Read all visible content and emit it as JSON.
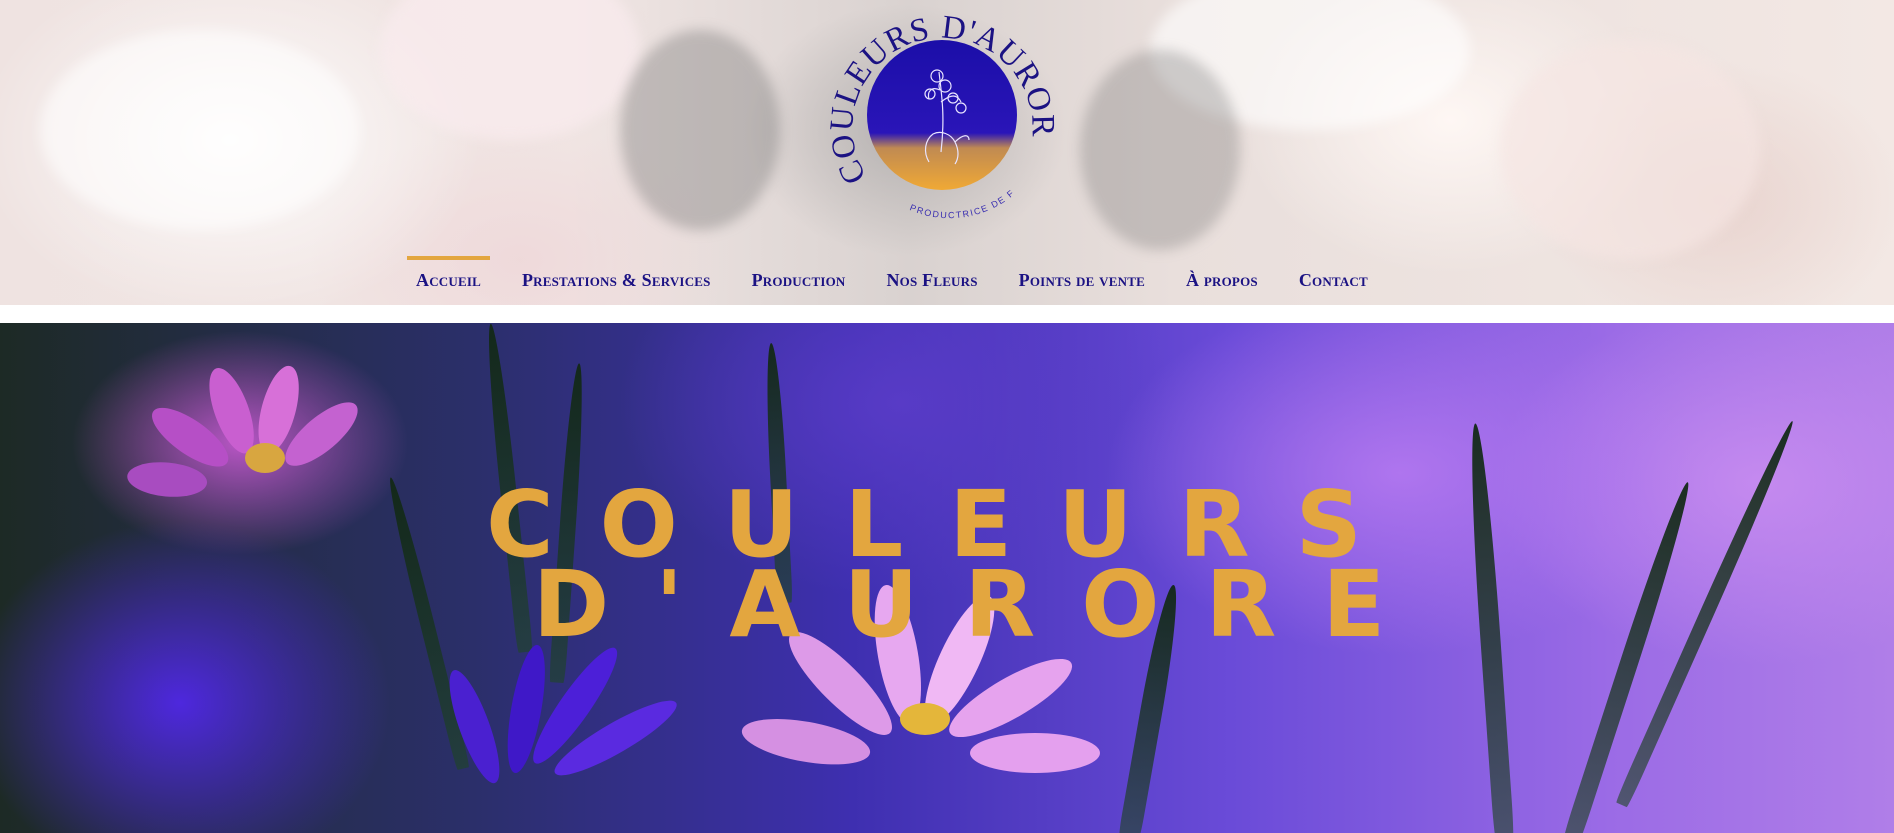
{
  "header": {
    "logo": {
      "brand_name": "COULEURS D'AURORE",
      "tagline": "PRODUCTRICE DE FLEURS"
    },
    "nav": [
      {
        "label": "Accueil",
        "active": true
      },
      {
        "label": "Prestations & Services",
        "active": false
      },
      {
        "label": "Production",
        "active": false
      },
      {
        "label": "Nos Fleurs",
        "active": false
      },
      {
        "label": "Points de vente",
        "active": false
      },
      {
        "label": "À propos",
        "active": false
      },
      {
        "label": "Contact",
        "active": false
      }
    ]
  },
  "hero": {
    "title_line1": "COULEURS",
    "title_line2": "D'AURORE"
  },
  "colors": {
    "accent_gold": "#e3a63f",
    "nav_text": "#1b1283",
    "logo_indigo": "#1f0fb0"
  }
}
